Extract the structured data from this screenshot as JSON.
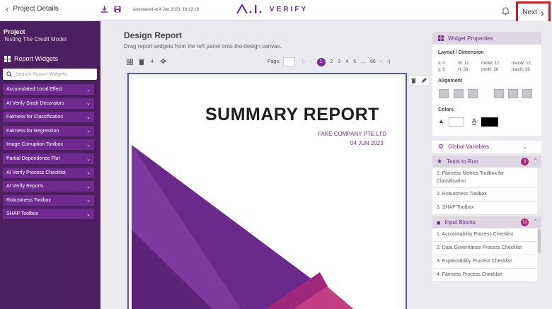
{
  "topbar": {
    "back_label": "Project Details",
    "autosave": "Autosaved at 4 Jun 2023, 16:13:19",
    "logo_text": "VERIFY",
    "next_label": "Next"
  },
  "sidebar": {
    "project_heading": "Project",
    "project_name": "Testing The Credit Model",
    "widgets_title": "Report Widgets",
    "search_placeholder": "Search Report Widgets",
    "items": [
      "Accumulated Local Effect",
      "AI Verify Stock Decorators",
      "Fairness for Classification",
      "Fairness for Regression",
      "Image Corruption Toolbox",
      "Partial Dependence Plot",
      "AI Verify Process Checklist",
      "AI Verify Reports",
      "Robustness Toolbox",
      "SHAP Toolbox"
    ]
  },
  "canvas": {
    "title": "Design Report",
    "subtitle": "Drag report widgets from the left panel onto the design canvas.",
    "page_label": "Page:",
    "pages": [
      "2",
      "3",
      "4",
      "5",
      "...",
      "66"
    ],
    "current_page": "1",
    "report_title": "SUMMARY REPORT",
    "company": "FAKE COMPANY PTE LTD",
    "date": "04 JUN 2023"
  },
  "properties": {
    "title": "Widget Properties",
    "layout_heading": "Layout / Dimension",
    "layout": {
      "x": "x: 0",
      "y": "y: 0",
      "w": "W: 12",
      "h": "H: 36",
      "minw": "minW: 12",
      "minh": "minH: 36",
      "maxw": "maxW: 12",
      "maxh": "maxH: 36"
    },
    "alignment_heading": "Alignment",
    "colors_heading": "Colors",
    "fill_color": "#ffffff",
    "text_color": "#000000"
  },
  "global_vars": {
    "title": "Global Variables"
  },
  "tests": {
    "title": "Tests to Run",
    "count": "3",
    "items": [
      "1.  Fairness Metrics Toolbox for Classification",
      "2.  Robustness Toolbox",
      "3.  SHAP Toolbox"
    ]
  },
  "inputs": {
    "title": "Input Blocks",
    "count": "12",
    "items": [
      "1.  Accountability Process Checklist",
      "2.  Data Governance Process Checklist",
      "3.  Explainability Process Checklist",
      "4.  Fairness Process Checklist"
    ]
  },
  "colors": {
    "brand": "#6e2a8e",
    "sidebar": "#4d1f60",
    "highlight": "#e0141e"
  }
}
